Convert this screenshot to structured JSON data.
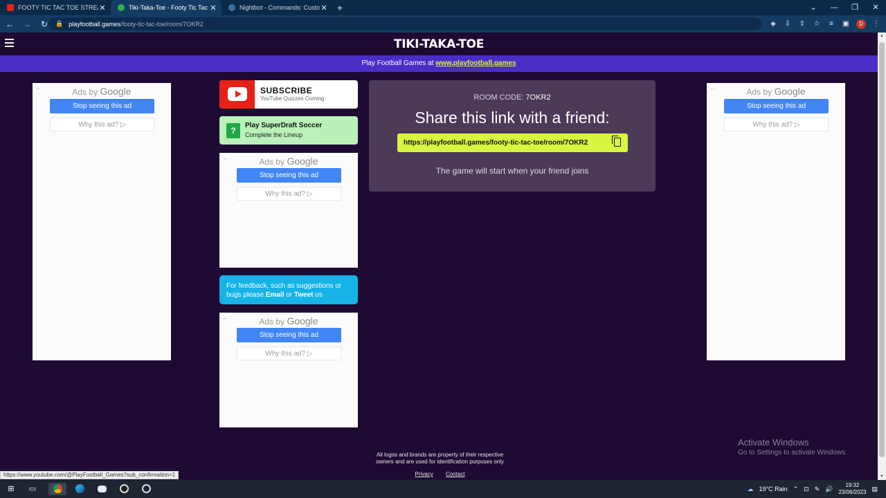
{
  "browser": {
    "tabs": [
      {
        "title": "FOOTY TIC TAC TOE STREAM - Yo",
        "favicon_color": "#e62117"
      },
      {
        "title": "Tiki-Taka-Toe - Footy Tic Tac Toe",
        "favicon_color": "#2fb34a"
      },
      {
        "title": "Nightbot - Commands: Custom",
        "favicon_color": "#1e4b73"
      }
    ],
    "url_host": "playfootball.games",
    "url_path": "/footy-tic-tac-toe/room/7OKR2",
    "profile_initial": "D"
  },
  "site": {
    "title": "TIKI-TAKA-TOE",
    "promo_prefix": "Play Football Games at",
    "promo_link": "www.playfootball.games"
  },
  "ads": {
    "ads_by": "Ads by",
    "google": "Google",
    "stop": "Stop seeing this ad",
    "why": "Why this ad? ▷"
  },
  "subscribe": {
    "title": "SUBSCRIBE",
    "subtitle": "YouTube Quizzes Coming"
  },
  "superdraft": {
    "icon": "?",
    "title": "Play SuperDraft Soccer",
    "subtitle": "Complete the Lineup"
  },
  "feedback": {
    "text1": "For feedback, such as suggestions or bugs please",
    "email": "Email",
    "or": "or",
    "tweet": "Tweet",
    "us": "us"
  },
  "room": {
    "code_label": "ROOM CODE:",
    "code": "7OKR2",
    "share_heading": "Share this link with a friend:",
    "link": "https://playfootball.games/footy-tic-tac-toe/room/7OKR2",
    "wait_text": "The game will start when your friend joins"
  },
  "footer": {
    "disclaimer": "All logos and brands are property of their respective owners and are used for identification purposes only",
    "privacy": "Privacy",
    "contact": "Contact"
  },
  "windows_watermark": {
    "line1": "Activate Windows",
    "line2": "Go to Settings to activate Windows."
  },
  "status_url": "https://www.youtube.com/@PlayFootball_Games?sub_confirmation=1",
  "taskbar": {
    "weather": "19°C Rain",
    "time": "19:32",
    "date": "23/06/2023"
  }
}
